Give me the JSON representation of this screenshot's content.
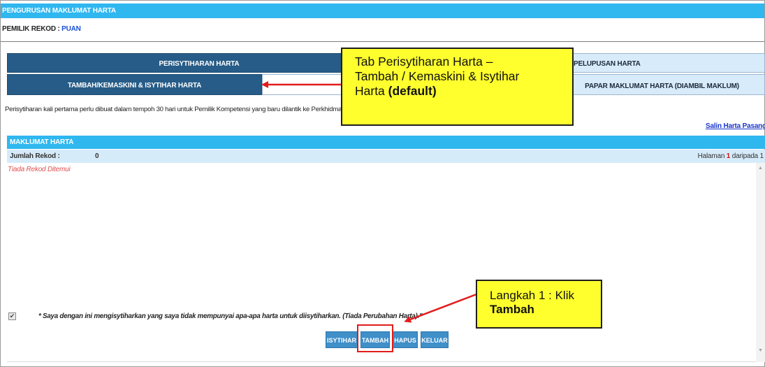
{
  "header": {
    "title": "PENGURUSAN MAKLUMAT HARTA",
    "owner_label": "PEMILIK REKOD : ",
    "owner_value": "PUAN"
  },
  "tabs": {
    "main": [
      {
        "label": "PERISYTIHARAN HARTA",
        "active": true
      },
      {
        "label": "PELUPUSAN HARTA",
        "active": false
      }
    ],
    "sub": [
      {
        "label": "TAMBAH/KEMASKINI & ISYTIHAR HARTA",
        "active": true
      },
      {
        "label": "",
        "active": false
      },
      {
        "label": "PAPAR MAKLUMAT HARTA (DIAMBIL MAKLUM)",
        "active": false
      }
    ]
  },
  "notice": "Perisytiharan kali pertama perlu dibuat dalam tempoh 30 hari untuk Pemilik Kompetensi yang baru dilantik ke Perkhidmatan Awam d",
  "copy_link": "Salin Harta Pasangan",
  "section": {
    "title": "MAKLUMAT HARTA",
    "record_label": "Jumlah Rekod :",
    "record_count": "0",
    "pagination": {
      "prefix": "Halaman ",
      "current": "1",
      "middle": " daripada ",
      "total": "1"
    },
    "empty_message": "Tiada Rekod Ditemui"
  },
  "declaration": {
    "checked": true,
    "text": "* Saya dengan ini mengisytiharkan yang saya tidak mempunyai apa-apa harta untuk diisytiharkan. (Tiada Perubahan Harta).\""
  },
  "buttons": {
    "isytihar": "ISYTIHAR",
    "tambah": "TAMBAH",
    "hapus": "HAPUS",
    "keluar": "KELUAR"
  },
  "annotations": {
    "tab_callout": {
      "line1": "Tab Perisytiharan Harta –",
      "line2": "Tambah / Kemaskini & Isytihar",
      "line3_plain": "Harta ",
      "line3_bold": "(default)"
    },
    "step_callout": {
      "line1": "Langkah 1 : Klik",
      "line2_bold": "Tambah"
    }
  },
  "colors": {
    "header_blue": "#2fb7f0",
    "tab_active": "#265c87",
    "tab_inactive": "#d8ebfb",
    "button": "#3f8fc9",
    "callout": "#ffff2e",
    "annotation_red": "#e21c1c"
  }
}
